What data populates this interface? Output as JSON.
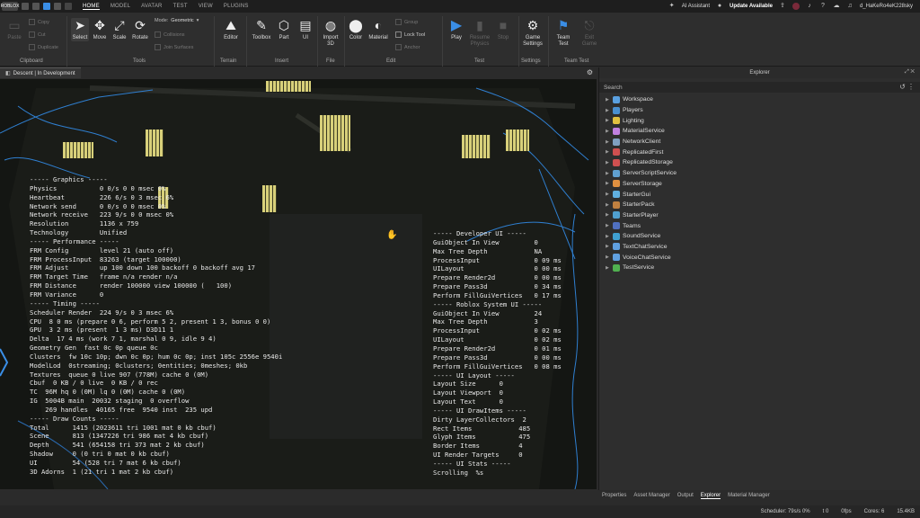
{
  "titlebar": {
    "logo": "ROBLOX",
    "tabs": [
      "HOME",
      "MODEL",
      "AVATAR",
      "TEST",
      "VIEW",
      "PLUGINS"
    ],
    "ai_assistant": "AI Assistant",
    "update": "Update Available",
    "username": "d_HaKeRo4eK228sky"
  },
  "ribbon": {
    "clipboard": {
      "paste": "Paste",
      "copy": "Copy",
      "cut": "Cut",
      "duplicate": "Duplicate",
      "label": "Clipboard"
    },
    "tools": {
      "select": "Select",
      "move": "Move",
      "scale": "Scale",
      "rotate": "Rotate",
      "mode_label": "Mode:",
      "mode_value": "Geometric",
      "collisions": "Collisions",
      "join_surfaces": "Join Surfaces",
      "label": "Tools"
    },
    "terrain": {
      "editor": "Editor",
      "label": "Terrain"
    },
    "insert": {
      "toolbox": "Toolbox",
      "part": "Part",
      "ui": "UI",
      "label": "Insert"
    },
    "file": {
      "import3d": "Import\n3D",
      "label": "File"
    },
    "edit": {
      "color": "Color",
      "material": "Material",
      "group": "Group",
      "lock_tool": "Lock Tool",
      "anchor": "Anchor",
      "label": "Edit"
    },
    "test": {
      "play": "Play",
      "resume": "Resume\nPhysics",
      "stop": "Stop",
      "label": "Test"
    },
    "settings": {
      "game_settings": "Game\nSettings",
      "label": "Settings"
    },
    "team_test": {
      "team_test": "Team\nTest",
      "exit_game": "Exit\nGame",
      "label": "Team Test"
    }
  },
  "viewport": {
    "tab_title": "Descent | In Development",
    "stats_left": [
      "----- Graphics -----",
      "Physics           0 0/s 0 0 msec 0%",
      "Heartbeat         226 6/s 0 3 msec 6%",
      "Network send      0 0/s 0 0 msec 0%",
      "Network receive   223 9/s 0 0 msec 0%",
      "Resolution        1136 x 759",
      "Technology        Unified",
      "----- Performance -----",
      "FRM Config        level 21 (auto off)",
      "FRM ProcessInput  83263 (target 100000)",
      "FRM Adjust        up 100 down 100 backoff 0 backoff avg 17",
      "FRM Target Time   frame n/a render n/a",
      "FRM Distance      render 100000 view 100000 (   100)",
      "FRM Variance      0",
      "----- Timing -----",
      "Scheduler Render  224 9/s 0 3 msec 6%",
      "CPU  8 0 ms (prepare 0 6, perform 5 2, present 1 3, bonus 0 0)",
      "GPU  3 2 ms (present  1 3 ms) D3D11 1",
      "Delta  17 4 ms (work 7 1, marshal 0 9, idle 9 4)",
      "Geometry Gen  fast 0c 0p queue 0c",
      "Clusters  fw 10c 10p; dwn 0c 0p; hum 0c 0p; inst 105c 2556e 9540i",
      "ModelLod  0streaming; 0clusters; 0entities; 0meshes; 0kb",
      "Textures  queue 0 live 907 (778M) cache 0 (0M)",
      "Cbuf  0 KB / 0 live  0 KB / 0 rec",
      "TC  96M hq 0 (0M) lq 0 (0M) cache 0 (0M)",
      "IG  5004B main  20032 staging  0 overflow",
      "    269 handles  40165 free  9540 inst  235 upd",
      "----- Draw Counts -----",
      "Total      1415 (2023611 tri 1001 mat 0 kb cbuf)",
      "Scene      813 (1347226 tri 986 mat 4 kb cbuf)",
      "Depth      541 (654158 tri 373 mat 2 kb cbuf)",
      "Shadow     0 (0 tri 0 mat 0 kb cbuf)",
      "UI         54 (528 tri 7 mat 6 kb cbuf)",
      "3D Adorns  1 (21 tri 1 mat 2 kb cbuf)"
    ],
    "stats_right": [
      "----- Developer UI -----",
      "GuiObject In View         0",
      "Max Tree Depth            NA",
      "ProcessInput              0 09 ms",
      "UILayout                  0 00 ms",
      "Prepare Render2d          0 00 ms",
      "Prepare Pass3d            0 34 ms",
      "Perform FillGuiVertices   0 17 ms",
      "----- Roblox System UI -----",
      "GuiObject In View         24",
      "Max Tree Depth            3",
      "ProcessInput              0 02 ms",
      "UILayout                  0 02 ms",
      "Prepare Render2d          0 01 ms",
      "Prepare Pass3d            0 00 ms",
      "Perform FillGuiVertices   0 08 ms",
      "----- UI Layout -----",
      "Layout Size      0",
      "Layout Viewport  0",
      "Layout Text      0",
      "----- UI DrawItems -----",
      "Dirty LayerCollectors  2",
      "Rect Items            485",
      "Glyph Items           475",
      "Border Items          4",
      "UI Render Targets     0",
      "----- UI Stats -----",
      "Scrolling  %s"
    ]
  },
  "explorer": {
    "title": "Explorer",
    "search_placeholder": "Search",
    "items": [
      {
        "label": "Workspace",
        "color": "#5aa0e0"
      },
      {
        "label": "Players",
        "color": "#4a90d0"
      },
      {
        "label": "Lighting",
        "color": "#e0c040"
      },
      {
        "label": "MaterialService",
        "color": "#c080e0"
      },
      {
        "label": "NetworkClient",
        "color": "#80a0c0"
      },
      {
        "label": "ReplicatedFirst",
        "color": "#d05050"
      },
      {
        "label": "ReplicatedStorage",
        "color": "#d05050"
      },
      {
        "label": "ServerScriptService",
        "color": "#60a0d0"
      },
      {
        "label": "ServerStorage",
        "color": "#e09040"
      },
      {
        "label": "StarterGui",
        "color": "#60b0e0"
      },
      {
        "label": "StarterPack",
        "color": "#c08040"
      },
      {
        "label": "StarterPlayer",
        "color": "#50a0d0"
      },
      {
        "label": "Teams",
        "color": "#5070c0"
      },
      {
        "label": "SoundService",
        "color": "#40a0d0"
      },
      {
        "label": "TextChatService",
        "color": "#60a0e0"
      },
      {
        "label": "VoiceChatService",
        "color": "#60a0e0"
      },
      {
        "label": "TestService",
        "color": "#50b050"
      }
    ]
  },
  "bottom_tabs": [
    "Properties",
    "Asset Manager",
    "Output",
    "Explorer",
    "Material Manager"
  ],
  "bottom_tabs_active": "Explorer",
  "statusbar": {
    "scheduler": "Scheduler: 79s/s 0%",
    "t": "t 0",
    "fps": "0fps",
    "cores": "Cores: 6",
    "mem": "15.4KB"
  }
}
